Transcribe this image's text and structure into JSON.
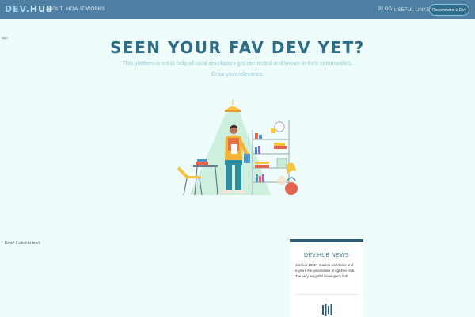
{
  "nav": {
    "logo_a": "DEV.",
    "logo_b": "HUB",
    "about": "ABOUT",
    "how": "HOW IT WORKS",
    "blog": "BLOG",
    "links": "USEFUL LINKS",
    "links_caret": "▾",
    "cta": "Recommend a Dev"
  },
  "broken_image_alt": "logo",
  "hero": {
    "title": "SEEN YOUR FAV DEV YET?",
    "subtitle": "This platform is set to help all local developers get connected and known in their communities.",
    "tagline": "Grow your relevance."
  },
  "error_text": "Error! Failed to fetch",
  "news": {
    "title": "DEV.HUB NEWS",
    "body": "Join our 1000+ readers worldwide and explore the possibilities of eghDev Hub. The very insightful developer's hub",
    "icon": "bars-icon"
  },
  "colors": {
    "nav": "#4f7fa2",
    "background": "#eefcfb",
    "title": "#2f6d86",
    "cta": "#2e6f8c",
    "lamp_light": "#c5ecd8"
  }
}
